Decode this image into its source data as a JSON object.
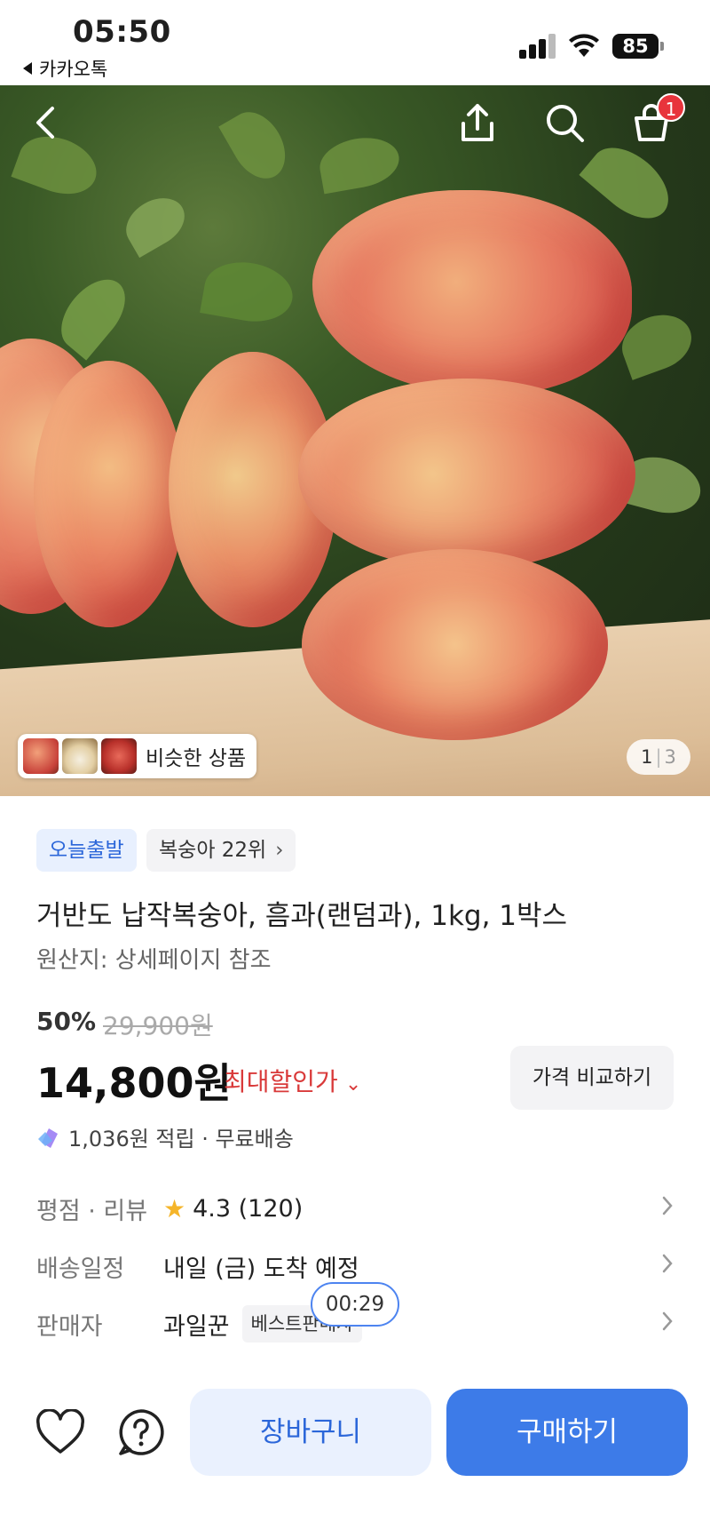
{
  "status_bar": {
    "time": "05:50",
    "back_app": "카카오톡",
    "battery": "85"
  },
  "header": {
    "cart_badge": "1"
  },
  "gallery": {
    "similar_label": "비슷한 상품",
    "page_current": "1",
    "page_total": "3"
  },
  "product": {
    "chip_today": "오늘출발",
    "chip_rank": "복숭아 22위",
    "title": "거반도 납작복숭아, 흠과(랜덤과), 1kg, 1박스",
    "origin": "원산지: 상세페이지 참조",
    "discount": "50%",
    "original_price": "29,900원",
    "price": "14,800원",
    "max_discount": "최대할인가",
    "compare_label": "가격 비교하기",
    "points": "1,036원 적립 · 무료배송"
  },
  "info": {
    "rating_label": "평점 · 리뷰",
    "rating_value": "4.3 (120)",
    "delivery_label": "배송일정",
    "delivery_value": "내일 (금) 도착 예정",
    "seller_label": "판매자",
    "seller_value": "과일꾼",
    "seller_badge": "베스트판매자",
    "timer": "00:29"
  },
  "actions": {
    "cart_label": "장바구니",
    "buy_label": "구매하기"
  },
  "colors": {
    "accent": "#3d7be8",
    "discount_red": "#d93a3a",
    "badge_red": "#e8343c"
  },
  "icons": [
    "back-icon",
    "share-icon",
    "search-icon",
    "cart-icon",
    "heart-icon",
    "question-icon",
    "star-icon",
    "chevron-right-icon"
  ]
}
